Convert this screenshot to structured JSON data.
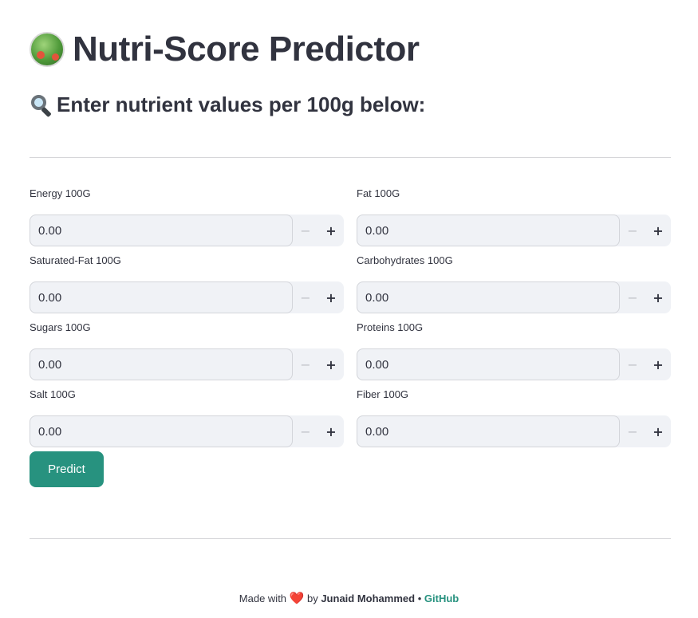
{
  "header": {
    "title_icon": "green-salad-icon",
    "title": "Nutri-Score Predictor",
    "subtitle_icon": "magnifying-glass-icon",
    "subtitle": "Enter nutrient values per 100g below:"
  },
  "form": {
    "fields": [
      {
        "label": "Energy 100G",
        "value": "0.00"
      },
      {
        "label": "Fat 100G",
        "value": "0.00"
      },
      {
        "label": "Saturated-Fat 100G",
        "value": "0.00"
      },
      {
        "label": "Carbohydrates 100G",
        "value": "0.00"
      },
      {
        "label": "Sugars 100G",
        "value": "0.00"
      },
      {
        "label": "Proteins 100G",
        "value": "0.00"
      },
      {
        "label": "Salt 100G",
        "value": "0.00"
      },
      {
        "label": "Fiber 100G",
        "value": "0.00"
      }
    ],
    "decrement_symbol": "−",
    "increment_symbol": "+",
    "submit_label": "Predict"
  },
  "footer": {
    "prefix": "Made with",
    "heart": "❤️",
    "by": "by",
    "author": "Junaid Mohammed",
    "separator": "•",
    "link_label": "GitHub"
  },
  "colors": {
    "accent": "#27927f",
    "input_bg": "#f0f2f6",
    "text": "#31333f",
    "heart": "#e0232e"
  }
}
